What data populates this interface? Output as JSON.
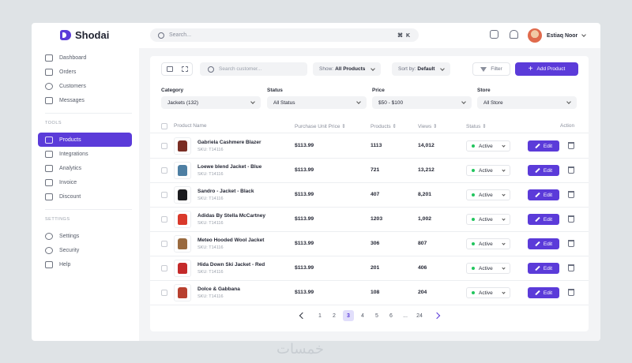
{
  "app": {
    "name": "Shodai",
    "brand_color": "#5b3bd9"
  },
  "search": {
    "placeholder": "Search...",
    "shortcut": "⌘ K"
  },
  "user": {
    "name": "Estiaq Noor"
  },
  "sidebar": {
    "main_items": [
      {
        "label": "Dashboard",
        "icon": "home-icon"
      },
      {
        "label": "Orders",
        "icon": "orders-icon"
      },
      {
        "label": "Customers",
        "icon": "users-icon"
      },
      {
        "label": "Messages",
        "icon": "message-icon"
      }
    ],
    "tools_title": "TOOLS",
    "tools_items": [
      {
        "label": "Products",
        "icon": "box-icon",
        "active": true
      },
      {
        "label": "Integrations",
        "icon": "integrations-icon"
      },
      {
        "label": "Analytics",
        "icon": "analytics-icon"
      },
      {
        "label": "Invoice",
        "icon": "invoice-icon"
      },
      {
        "label": "Discount",
        "icon": "discount-icon"
      }
    ],
    "settings_title": "SETTINGS",
    "settings_items": [
      {
        "label": "Settings",
        "icon": "gear-icon"
      },
      {
        "label": "Security",
        "icon": "shield-icon"
      },
      {
        "label": "Help",
        "icon": "help-icon"
      }
    ]
  },
  "toolbar": {
    "search_placeholder": "Search customer...",
    "show_prefix": "Show:",
    "show_value": "All Products",
    "sort_prefix": "Sort by:",
    "sort_value": "Default",
    "filter_label": "Filter",
    "add_label": "Add Product"
  },
  "filters": [
    {
      "label": "Category",
      "value": "Jackets (132)"
    },
    {
      "label": "Status",
      "value": "All Status"
    },
    {
      "label": "Price",
      "value": "$50 - $100"
    },
    {
      "label": "Store",
      "value": "All Store"
    }
  ],
  "table": {
    "headers": {
      "product": "Product Name",
      "price": "Purchase Unit Price",
      "products": "Products",
      "views": "Views",
      "status": "Status",
      "action": "Action"
    },
    "sort_icon": "⇕",
    "edit_label": "Edit",
    "rows": [
      {
        "name": "Gabriela Cashmere Blazer",
        "sku": "SKU: T14116",
        "price": "$113.99",
        "products": "1113",
        "views": "14,012",
        "status": "Active",
        "color": "#7a2e24"
      },
      {
        "name": "Loewe blend Jacket - Blue",
        "sku": "SKU: T14116",
        "price": "$113.99",
        "products": "721",
        "views": "13,212",
        "status": "Active",
        "color": "#4e7fa3"
      },
      {
        "name": "Sandro - Jacket - Black",
        "sku": "SKU: T14116",
        "price": "$113.99",
        "products": "407",
        "views": "8,201",
        "status": "Active",
        "color": "#1c1c1f"
      },
      {
        "name": "Adidas By Stella McCartney",
        "sku": "SKU: T14116",
        "price": "$113.99",
        "products": "1203",
        "views": "1,002",
        "status": "Active",
        "color": "#d9392b"
      },
      {
        "name": "Meteo Hooded Wool Jacket",
        "sku": "SKU: T14116",
        "price": "$113.99",
        "products": "306",
        "views": "807",
        "status": "Active",
        "color": "#9a6a3f"
      },
      {
        "name": "Hida Down Ski Jacket - Red",
        "sku": "SKU: T14116",
        "price": "$113.99",
        "products": "201",
        "views": "406",
        "status": "Active",
        "color": "#c42a2a"
      },
      {
        "name": "Dolce & Gabbana",
        "sku": "SKU: T14116",
        "price": "$113.99",
        "products": "108",
        "views": "204",
        "status": "Active",
        "color": "#b8402f"
      }
    ]
  },
  "pagination": {
    "pages": [
      "1",
      "2",
      "3",
      "4",
      "5",
      "6",
      "...",
      "24"
    ],
    "current": "3"
  },
  "watermark": "خمسات"
}
